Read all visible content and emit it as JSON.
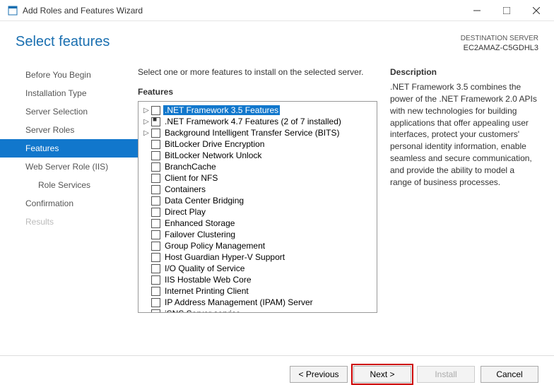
{
  "window": {
    "title": "Add Roles and Features Wizard"
  },
  "header": {
    "title": "Select features",
    "dest_label": "DESTINATION SERVER",
    "dest_value": "EC2AMAZ-C5GDHL3"
  },
  "nav": [
    {
      "label": "Before You Begin",
      "selected": false,
      "level": 1
    },
    {
      "label": "Installation Type",
      "selected": false,
      "level": 1
    },
    {
      "label": "Server Selection",
      "selected": false,
      "level": 1
    },
    {
      "label": "Server Roles",
      "selected": false,
      "level": 1
    },
    {
      "label": "Features",
      "selected": true,
      "level": 1
    },
    {
      "label": "Web Server Role (IIS)",
      "selected": false,
      "level": 1
    },
    {
      "label": "Role Services",
      "selected": false,
      "level": 2
    },
    {
      "label": "Confirmation",
      "selected": false,
      "level": 1
    },
    {
      "label": "Results",
      "selected": false,
      "level": 1,
      "disabled": true
    }
  ],
  "content": {
    "instruction": "Select one or more features to install on the selected server.",
    "features_label": "Features",
    "description_label": "Description",
    "description_text": ".NET Framework 3.5 combines the power of the .NET Framework 2.0 APIs with new technologies for building applications that offer appealing user interfaces, protect your customers' personal identity information, enable seamless and secure communication, and provide the ability to model a range of business processes."
  },
  "features": [
    {
      "label": ".NET Framework 3.5 Features",
      "expand": true,
      "selected": true
    },
    {
      "label": ".NET Framework 4.7 Features (2 of 7 installed)",
      "expand": true,
      "filled": true
    },
    {
      "label": "Background Intelligent Transfer Service (BITS)",
      "expand": true
    },
    {
      "label": "BitLocker Drive Encryption"
    },
    {
      "label": "BitLocker Network Unlock"
    },
    {
      "label": "BranchCache"
    },
    {
      "label": "Client for NFS"
    },
    {
      "label": "Containers"
    },
    {
      "label": "Data Center Bridging"
    },
    {
      "label": "Direct Play"
    },
    {
      "label": "Enhanced Storage"
    },
    {
      "label": "Failover Clustering"
    },
    {
      "label": "Group Policy Management"
    },
    {
      "label": "Host Guardian Hyper-V Support"
    },
    {
      "label": "I/O Quality of Service"
    },
    {
      "label": "IIS Hostable Web Core"
    },
    {
      "label": "Internet Printing Client"
    },
    {
      "label": "IP Address Management (IPAM) Server"
    },
    {
      "label": "iSNS Server service"
    }
  ],
  "footer": {
    "previous": "< Previous",
    "next": "Next >",
    "install": "Install",
    "cancel": "Cancel"
  }
}
